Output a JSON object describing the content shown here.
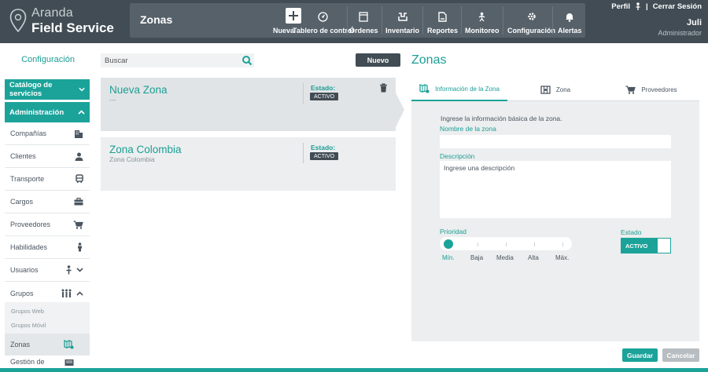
{
  "colors": {
    "accent": "#1ba39a",
    "header": "#414c54",
    "header_band": "#56616a"
  },
  "brand": {
    "top": "Aranda",
    "bottom": "Field Service"
  },
  "header": {
    "module_title": "Zonas",
    "toolbar": [
      {
        "icon": "plus-icon",
        "label": "Nueva"
      },
      {
        "icon": "dashboard-icon",
        "label": "Tablero de control"
      },
      {
        "icon": "orders-icon",
        "label": "Órdenes"
      },
      {
        "icon": "inventory-icon",
        "label": "Inventario"
      },
      {
        "icon": "reports-icon",
        "label": "Reportes"
      },
      {
        "icon": "monitoring-icon",
        "label": "Monitoreo"
      },
      {
        "icon": "gear-icon",
        "label": "Configuración"
      },
      {
        "icon": "bell-icon",
        "label": "Alertas"
      }
    ],
    "user": {
      "profile_link": "Perfil",
      "separator": "|",
      "logout_link": "Cerrar Sesión",
      "name": "Juli",
      "role": "Administrador"
    }
  },
  "sidebar": {
    "title": "Configuración",
    "catalog_label": "Catálogo de servicios",
    "admin_label": "Administración",
    "items": [
      {
        "label": "Compañías",
        "icon": "building-icon"
      },
      {
        "label": "Clientes",
        "icon": "person-icon"
      },
      {
        "label": "Transporte",
        "icon": "bus-icon"
      },
      {
        "label": "Cargos",
        "icon": "briefcase-icon"
      },
      {
        "label": "Proveedores",
        "icon": "cart-icon"
      },
      {
        "label": "Habilidades",
        "icon": "person-skill-icon"
      },
      {
        "label": "Usuarios",
        "icon": "user-icon"
      },
      {
        "label": "Grupos",
        "icon": "group-icon"
      }
    ],
    "sub_items": [
      "Grupos Web",
      "Grupos Móvil"
    ],
    "active_item": "Zonas",
    "last_item": "Gestión de"
  },
  "list": {
    "search_placeholder": "Buscar",
    "new_button": "Nuevo",
    "cards": [
      {
        "title": "Nueva Zona",
        "subtitle": "---",
        "status_label": "Estado:",
        "status": "ACTIVO"
      },
      {
        "title": "Zona Colombia",
        "subtitle": "Zona Colombia",
        "status_label": "Estado:",
        "status": "ACTIVO"
      }
    ]
  },
  "panel": {
    "title": "Zonas",
    "tabs": [
      {
        "label": "Información de la Zona",
        "icon": "zone-map-icon"
      },
      {
        "label": "Zona",
        "icon": "map-icon"
      },
      {
        "label": "Proveedores",
        "icon": "cart-icon"
      }
    ],
    "intro": "Ingrese la información básica de la zona.",
    "name_label": "Nombre de la zona",
    "name_value": "",
    "description_label": "Descripción",
    "description_placeholder": "Ingrese una descripción",
    "priority_label": "Prioridad",
    "priority_levels": [
      "Mín.",
      "Baja",
      "Media",
      "Alta",
      "Máx."
    ],
    "priority_selected": "Mín.",
    "status_label": "Estado",
    "status_value": "ACTIVO"
  },
  "actions": {
    "save": "Guardar",
    "cancel": "Cancelar"
  }
}
